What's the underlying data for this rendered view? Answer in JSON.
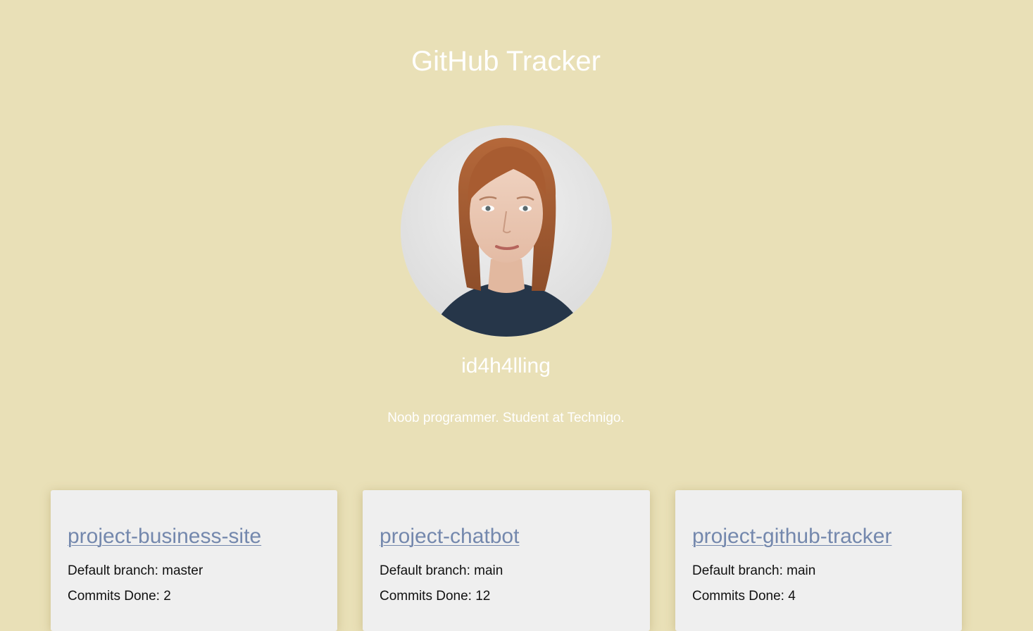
{
  "header": {
    "title": "GitHub Tracker"
  },
  "profile": {
    "avatar_alt": "profile photo",
    "username": "id4h4lling",
    "bio": "Noob programmer. Student at Technigo."
  },
  "repos": [
    {
      "name": "project-business-site",
      "branch_text": "Default branch: master",
      "commits_text": "Commits Done: 2"
    },
    {
      "name": "project-chatbot",
      "branch_text": "Default branch: main",
      "commits_text": "Commits Done: 12"
    },
    {
      "name": "project-github-tracker",
      "branch_text": "Default branch: main",
      "commits_text": "Commits Done: 4"
    }
  ],
  "colors": {
    "background": "#e9e0b7",
    "card": "#efefef",
    "link": "#7488ad",
    "heading_text": "#ffffff"
  }
}
